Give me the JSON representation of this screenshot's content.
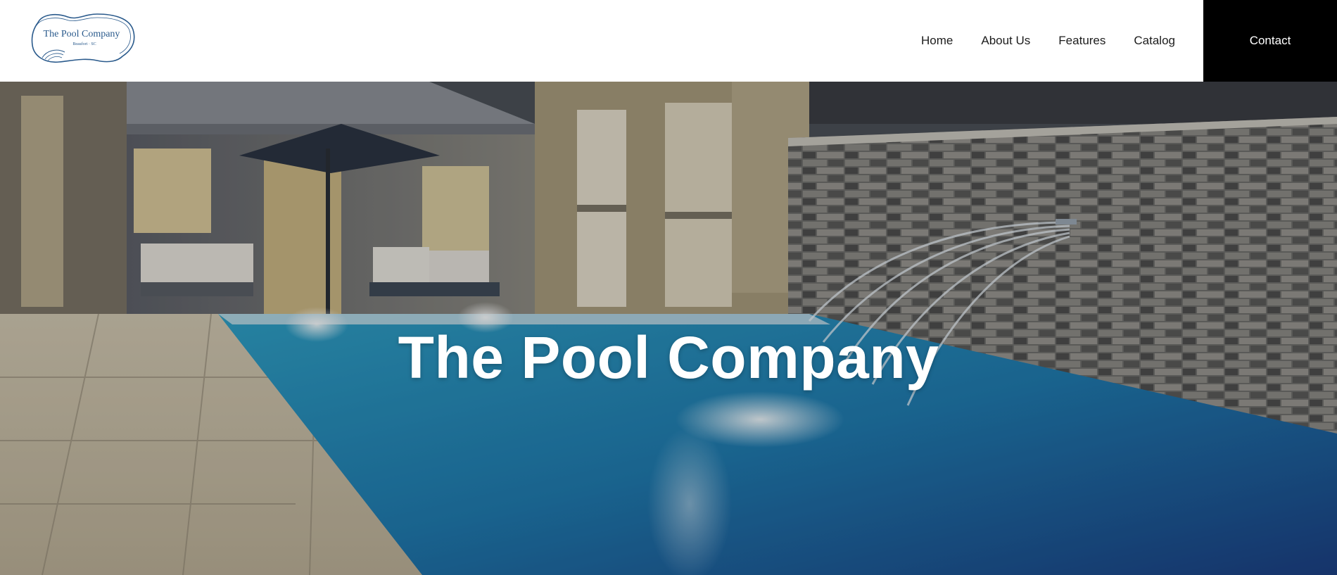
{
  "header": {
    "logo": {
      "name": "The Pool Company",
      "tagline": "Beaufort · SC"
    },
    "nav": [
      {
        "label": "Home"
      },
      {
        "label": "About Us"
      },
      {
        "label": "Features"
      },
      {
        "label": "Catalog"
      }
    ],
    "contact_label": "Contact"
  },
  "hero": {
    "title": "The Pool Company",
    "image_icon": "pool-backyard-photo"
  },
  "colors": {
    "brand_blue": "#2a5a8c",
    "contact_bg": "#000000",
    "contact_text": "#ffffff",
    "nav_text": "#1c1c1c"
  }
}
